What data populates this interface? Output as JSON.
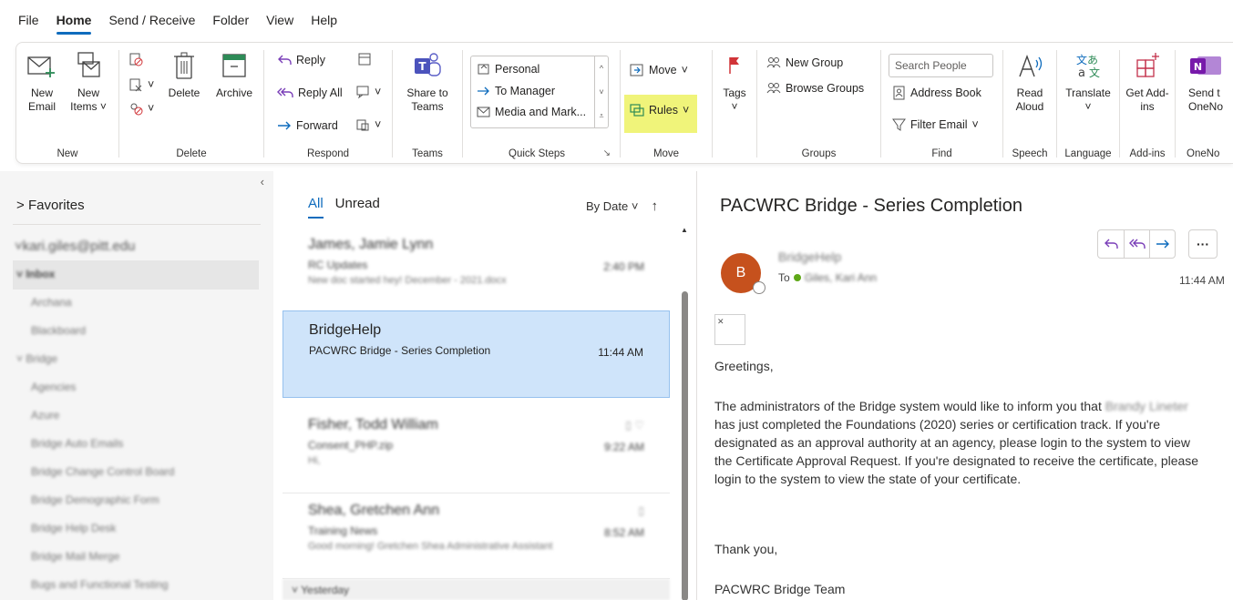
{
  "menu": [
    "File",
    "Home",
    "Send / Receive",
    "Folder",
    "View",
    "Help"
  ],
  "ribbon": {
    "new": {
      "new_email": "New Email",
      "new_items": "New Items",
      "group": "New"
    },
    "delete": {
      "delete": "Delete",
      "archive": "Archive",
      "group": "Delete"
    },
    "respond": {
      "reply": "Reply",
      "reply_all": "Reply All",
      "forward": "Forward",
      "group": "Respond"
    },
    "teams": {
      "share": "Share to Teams",
      "group": "Teams"
    },
    "quick_steps": {
      "items": [
        "Personal",
        "To Manager",
        "Media and Mark..."
      ],
      "group": "Quick Steps"
    },
    "move": {
      "move": "Move",
      "rules": "Rules",
      "group": "Move"
    },
    "tags": {
      "tags": "Tags"
    },
    "groups": {
      "new_group": "New Group",
      "browse_groups": "Browse Groups",
      "group": "Groups"
    },
    "find": {
      "search_placeholder": "Search People",
      "address_book": "Address Book",
      "filter_email": "Filter Email",
      "group": "Find"
    },
    "speech": {
      "read_aloud": "Read Aloud",
      "group": "Speech"
    },
    "language": {
      "translate": "Translate",
      "group": "Language"
    },
    "addins": {
      "get_addins": "Get Add-ins",
      "group": "Add-ins"
    },
    "onenote": {
      "send": "Send t OneNo",
      "group": "OneNo"
    }
  },
  "folders": {
    "favorites": "Favorites",
    "account": "kari.giles@pitt.edu",
    "items": [
      "Inbox",
      "Archana",
      "Blackboard",
      "Bridge",
      "Agencies",
      "Azure",
      "Bridge Auto Emails",
      "Bridge Change Control Board",
      "Bridge Demographic Form",
      "Bridge Help Desk",
      "Bridge Mail Merge",
      "Bugs and Functional Testing"
    ]
  },
  "messages": {
    "tabs": [
      "All",
      "Unread"
    ],
    "sort": "By Date",
    "items": [
      {
        "sender": "James, Jamie Lynn",
        "subject": "RC Updates",
        "preview": "New doc started hey! December - 2021.docx",
        "time": "2:40 PM"
      },
      {
        "sender": "BridgeHelp",
        "subject": "PACWRC Bridge - Series Completion",
        "preview": "",
        "time": "11:44 AM"
      },
      {
        "sender": "Fisher, Todd William",
        "subject": "Consent_PHP.zip",
        "preview": "Hi,",
        "time": "9:22 AM"
      },
      {
        "sender": "Shea, Gretchen Ann",
        "subject": "Training News",
        "preview": "Good morning! Gretchen Shea Administrative Assistant",
        "time": "8:52 AM"
      }
    ],
    "yesterday": "Yesterday"
  },
  "reading": {
    "title": "PACWRC Bridge - Series Completion",
    "avatar_letter": "B",
    "from": "BridgeHelp",
    "to_label": "To",
    "to_name": "Giles, Kari Ann",
    "time": "11:44 AM",
    "greeting": "Greetings,",
    "para_1": "The administrators of the Bridge system would like to inform you that",
    "person_first": "Brandy",
    "person_last": "Lineter",
    "para_2": "has just completed the Foundations (2020) series or certification track. If you're designated as an approval authority at an agency, please login to the system to view the Certificate Approval Request. If you're designated to receive the certificate, please login to the system to view the state of your certificate.",
    "thanks": "Thank you,",
    "signature": "PACWRC Bridge Team"
  },
  "colors": {
    "accent": "#0f6cbd",
    "selected": "#cfe4fa",
    "highlight": "#f0f47a",
    "avatar": "#c6511d",
    "flag": "#d13438"
  }
}
